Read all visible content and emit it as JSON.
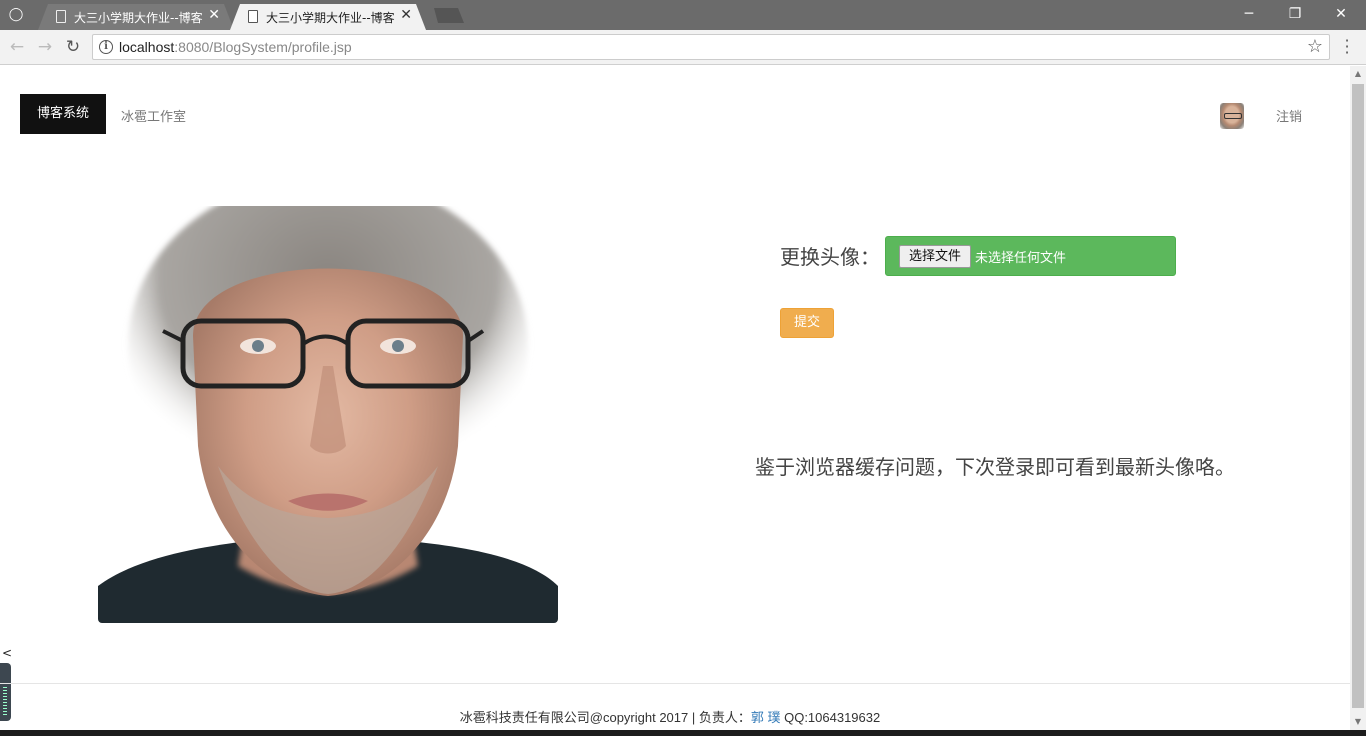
{
  "browser": {
    "tabs": [
      {
        "title": "大三小学期大作业--博客",
        "active": false
      },
      {
        "title": "大三小学期大作业--博客",
        "active": true
      }
    ],
    "url_host": "localhost",
    "url_rest": ":8080/BlogSystem/profile.jsp",
    "window_controls": {
      "minimize": "─",
      "restore": "❐",
      "close": "✕"
    }
  },
  "header": {
    "brand": "博客系统",
    "studio": "冰雹工作室",
    "logout": "注销"
  },
  "form": {
    "label": "更换头像：",
    "file_button": "选择文件",
    "file_status": "未选择任何文件",
    "submit": "提交"
  },
  "notice": "鉴于浏览器缓存问题，下次登录即可看到最新头像咯。",
  "stray_char": "<",
  "footer": {
    "prefix": "冰雹科技责任有限公司@copyright 2017 | 负责人：",
    "person": "郭 璞",
    "qq": " QQ:1064319632"
  },
  "colors": {
    "brand_bg": "#111111",
    "file_box": "#5cb85c",
    "submit": "#f0ad4e",
    "link": "#337ab7"
  }
}
